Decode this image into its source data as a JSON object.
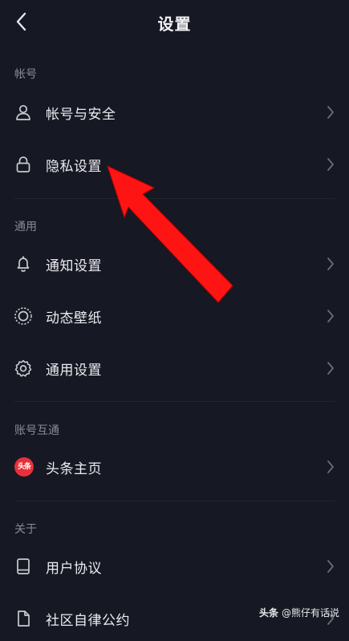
{
  "header": {
    "title": "设置",
    "back_icon": "back-chevron-icon"
  },
  "sections": [
    {
      "title": "帐号",
      "items": [
        {
          "label": "帐号与安全",
          "icon": "user-icon"
        },
        {
          "label": "隐私设置",
          "icon": "lock-icon"
        }
      ]
    },
    {
      "title": "通用",
      "items": [
        {
          "label": "通知设置",
          "icon": "bell-icon"
        },
        {
          "label": "动态壁纸",
          "icon": "wallpaper-icon"
        },
        {
          "label": "通用设置",
          "icon": "gear-icon"
        }
      ]
    },
    {
      "title": "账号互通",
      "items": [
        {
          "label": "头条主页",
          "icon": "toutiao-logo-icon",
          "icon_text": "头条"
        }
      ]
    },
    {
      "title": "关于",
      "items": [
        {
          "label": "用户协议",
          "icon": "book-icon"
        },
        {
          "label": "社区自律公约",
          "icon": "document-icon"
        }
      ]
    }
  ],
  "annotation": {
    "type": "red-arrow",
    "points_to": "隐私设置",
    "color": "#ff1414"
  },
  "watermark": {
    "brand": "头条",
    "handle": "@熊仔有话说"
  },
  "colors": {
    "background": "#161823",
    "text_primary": "#ececf1",
    "text_secondary": "#8a8b93",
    "icon": "#c9cad0",
    "chevron": "#6b6c75"
  }
}
